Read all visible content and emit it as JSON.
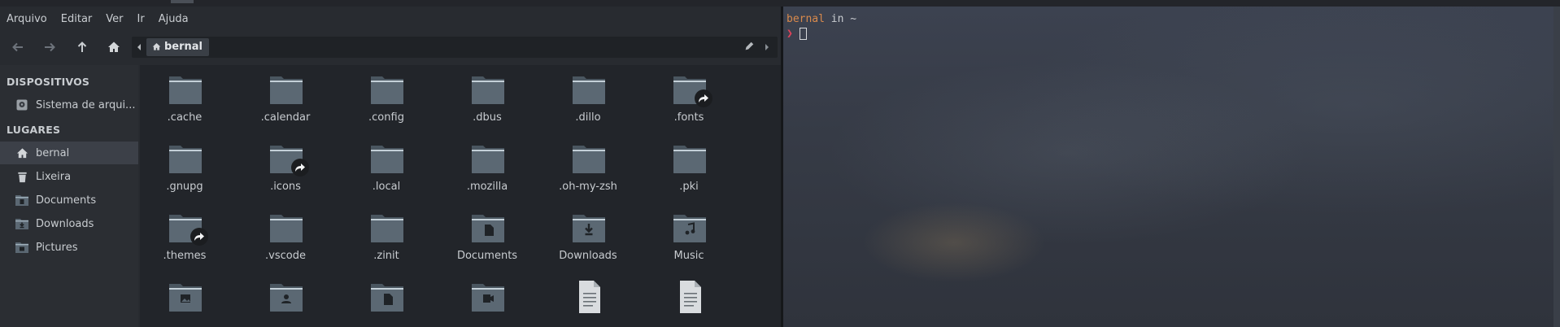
{
  "menu": [
    "Arquivo",
    "Editar",
    "Ver",
    "Ir",
    "Ajuda"
  ],
  "path": {
    "crumb": "bernal"
  },
  "sidebar": {
    "devices_heading": "DISPOSITIVOS",
    "devices": [
      {
        "label": "Sistema de arqui...",
        "icon": "drive-icon"
      }
    ],
    "places_heading": "LUGARES",
    "places": [
      {
        "label": "bernal",
        "icon": "home-icon",
        "selected": true
      },
      {
        "label": "Lixeira",
        "icon": "trash-icon"
      },
      {
        "label": "Documents",
        "icon": "documents-folder-icon"
      },
      {
        "label": "Downloads",
        "icon": "downloads-folder-icon"
      },
      {
        "label": "Pictures",
        "icon": "pictures-folder-icon"
      }
    ]
  },
  "files": [
    {
      "name": ".cache",
      "type": "folder"
    },
    {
      "name": ".calendar",
      "type": "folder"
    },
    {
      "name": ".config",
      "type": "folder"
    },
    {
      "name": ".dbus",
      "type": "folder"
    },
    {
      "name": ".dillo",
      "type": "folder"
    },
    {
      "name": ".fonts",
      "type": "folder",
      "symlink": true
    },
    {
      "name": ".gnupg",
      "type": "folder"
    },
    {
      "name": ".icons",
      "type": "folder",
      "symlink": true
    },
    {
      "name": ".local",
      "type": "folder"
    },
    {
      "name": ".mozilla",
      "type": "folder"
    },
    {
      "name": ".oh-my-zsh",
      "type": "folder"
    },
    {
      "name": ".pki",
      "type": "folder"
    },
    {
      "name": ".themes",
      "type": "folder",
      "symlink": true
    },
    {
      "name": ".vscode",
      "type": "folder"
    },
    {
      "name": ".zinit",
      "type": "folder"
    },
    {
      "name": "Documents",
      "type": "folder",
      "emblem": "document"
    },
    {
      "name": "Downloads",
      "type": "folder",
      "emblem": "download"
    },
    {
      "name": "Music",
      "type": "folder",
      "emblem": "music"
    },
    {
      "name": "",
      "type": "folder",
      "emblem": "picture"
    },
    {
      "name": "",
      "type": "folder",
      "emblem": "user"
    },
    {
      "name": "",
      "type": "folder",
      "emblem": "document"
    },
    {
      "name": "",
      "type": "folder",
      "emblem": "video"
    },
    {
      "name": "",
      "type": "textfile"
    },
    {
      "name": "",
      "type": "textfile"
    }
  ],
  "terminal": {
    "user": "bernal",
    "cwd_text": " in ~",
    "prompt_symbol": "❯"
  },
  "colors": {
    "folder": "#5b6873",
    "folder_tab": "#4a5660",
    "accent_user": "#d98a4c",
    "prompt": "#e0425a"
  }
}
